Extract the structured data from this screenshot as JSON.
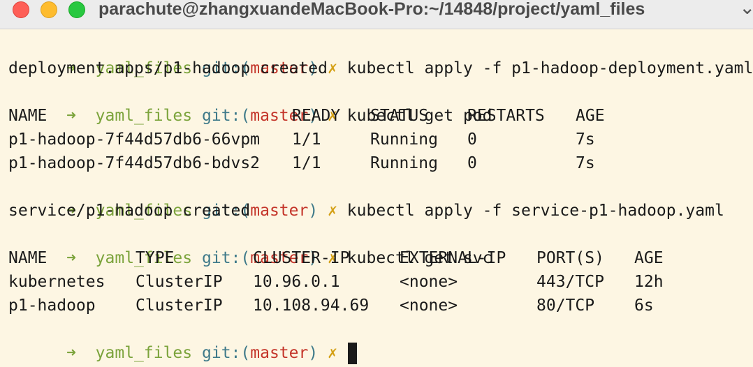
{
  "window": {
    "title": "parachute@zhangxuandeMacBook-Pro:~/14848/project/yaml_files"
  },
  "prompt": {
    "arrow": "➜",
    "dir": "yaml_files",
    "git_label": "git:(",
    "branch": "master",
    "git_close": ")",
    "dirty_mark": "✗"
  },
  "commands": [
    "kubectl apply -f p1-hadoop-deployment.yaml",
    "kubectl get pod",
    "kubectl apply -f service-p1-hadoop.yaml",
    "kubectl get svc"
  ],
  "outputs": {
    "deployment_created": "deployment.apps/p1-hadoop created",
    "service_created": "service/p1-hadoop created"
  },
  "pods": {
    "headers": [
      "NAME",
      "READY",
      "STATUS",
      "RESTARTS",
      "AGE"
    ],
    "rows": [
      [
        "p1-hadoop-7f44d57db6-66vpm",
        "1/1",
        "Running",
        "0",
        "7s"
      ],
      [
        "p1-hadoop-7f44d57db6-bdvs2",
        "1/1",
        "Running",
        "0",
        "7s"
      ]
    ]
  },
  "services": {
    "headers": [
      "NAME",
      "TYPE",
      "CLUSTER-IP",
      "EXTERNAL-IP",
      "PORT(S)",
      "AGE"
    ],
    "rows": [
      [
        "kubernetes",
        "ClusterIP",
        "10.96.0.1",
        "<none>",
        "443/TCP",
        "12h"
      ],
      [
        "p1-hadoop",
        "ClusterIP",
        "10.108.94.69",
        "<none>",
        "80/TCP",
        "6s"
      ]
    ]
  }
}
